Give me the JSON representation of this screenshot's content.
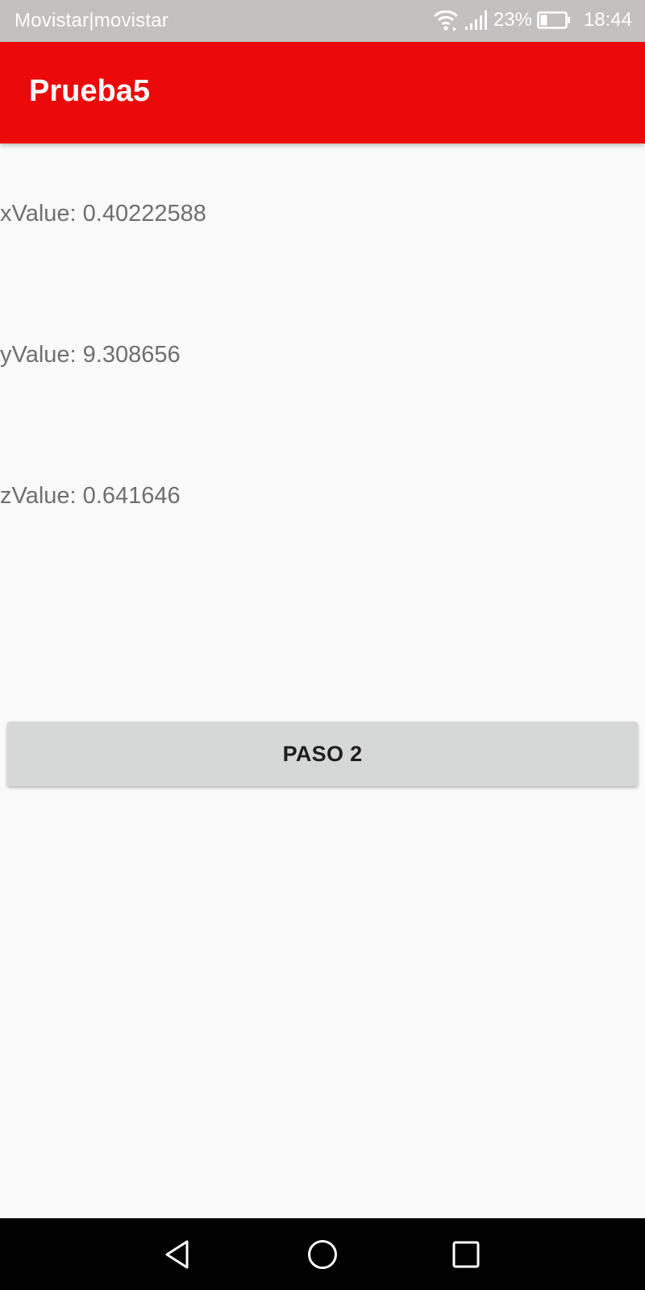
{
  "status_bar": {
    "carrier": "Movistar|movistar",
    "battery_percent": "23%",
    "time": "18:44",
    "icons": [
      "wifi-icon",
      "signal-icon",
      "battery-icon"
    ]
  },
  "app_bar": {
    "title": "Prueba5",
    "color": "#ec0909"
  },
  "sensor": {
    "x_text": "xValue: 0.40222588",
    "y_text": "yValue: 9.308656",
    "z_text": "zValue: 0.641646"
  },
  "button": {
    "label": "PASO 2"
  },
  "nav_bar": {
    "icons": [
      "back-icon",
      "home-icon",
      "recent-apps-icon"
    ]
  }
}
